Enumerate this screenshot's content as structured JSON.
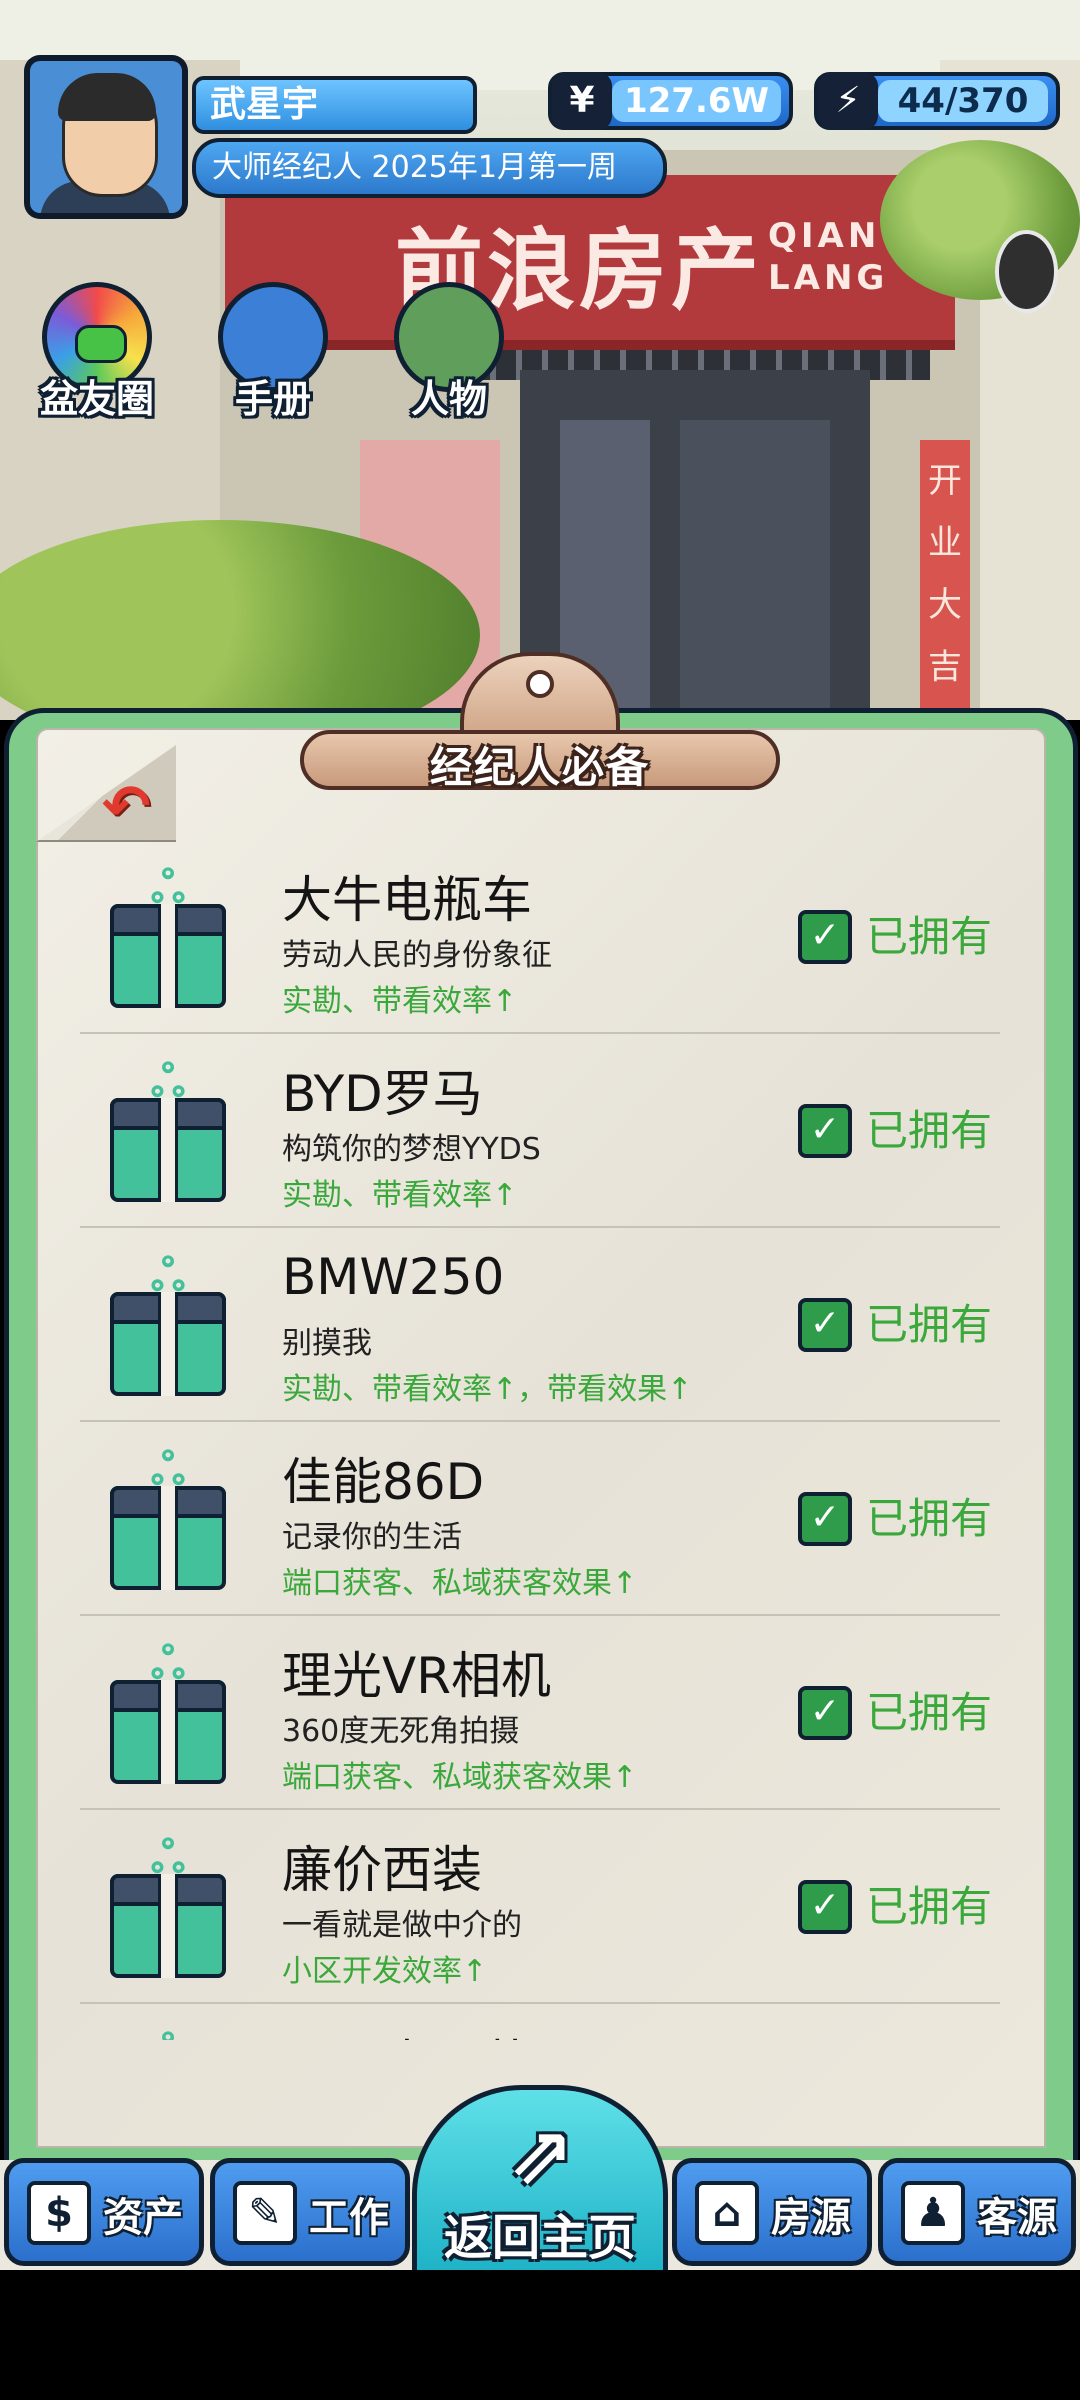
{
  "scene": {
    "store_sign_cn": "前浪房产",
    "store_sign_en_line1": "QIAN",
    "store_sign_en_line2": "LANG",
    "banner_text": "开业大吉"
  },
  "player": {
    "name": "武星宇",
    "title_date": "大师经纪人 2025年1月第一周",
    "money_icon": "¥",
    "money": "127.6W",
    "energy": "44/370"
  },
  "shortcuts": [
    {
      "label": "盆友圈",
      "icon": "moments-icon"
    },
    {
      "label": "手册",
      "icon": "handbook-icon"
    },
    {
      "label": "人物",
      "icon": "characters-icon"
    }
  ],
  "panel": {
    "title": "经纪人必备",
    "back_icon": "back-arrow-icon",
    "items": [
      {
        "name": "大牛电瓶车",
        "desc": "劳动人民的身份象征",
        "effect": "实勘、带看效率↑",
        "status": "已拥有"
      },
      {
        "name": "BYD罗马",
        "desc": "构筑你的梦想YYDS",
        "effect": "实勘、带看效率↑",
        "status": "已拥有"
      },
      {
        "name": "BMW250",
        "desc": "别摸我",
        "effect": "实勘、带看效率↑，带看效果↑",
        "status": "已拥有"
      },
      {
        "name": "佳能86D",
        "desc": "记录你的生活",
        "effect": "端口获客、私域获客效果↑",
        "status": "已拥有"
      },
      {
        "name": "理光VR相机",
        "desc": "360度无死角拍摄",
        "effect": "端口获客、私域获客效果↑",
        "status": "已拥有"
      },
      {
        "name": "廉价西装",
        "desc": "一看就是做中介的",
        "effect": "小区开发效率↑",
        "status": "已拥有"
      },
      {
        "name": "阿玛麦西装",
        "desc": "",
        "effect": "",
        "status": ""
      }
    ]
  },
  "nav": {
    "assets": "资产",
    "work": "工作",
    "home": "返回主页",
    "listings": "房源",
    "clients": "客源"
  },
  "colors": {
    "accent_blue": "#2f8fe0",
    "owned_green": "#3aa83a",
    "panel_green": "#7fcb8a",
    "gift_teal": "#42c19b"
  }
}
